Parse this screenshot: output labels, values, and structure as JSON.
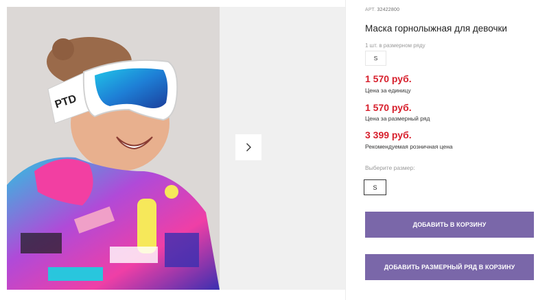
{
  "gallery": {
    "next_icon": "chevron-right-icon",
    "goggle_strap_text": "PTD"
  },
  "product": {
    "art_label": "АРТ.",
    "art_number": "32422800",
    "title": "Маска горнолыжная для девочки",
    "pack_label": "1 шт. в размерном ряду",
    "pack_size": "S"
  },
  "prices": [
    {
      "value": "1 570 руб.",
      "note": "Цена за единицу"
    },
    {
      "value": "1 570 руб.",
      "note": "Цена за размерный ряд"
    },
    {
      "value": "3 399 руб.",
      "note": "Рекомендуемая розничная цена"
    }
  ],
  "size_select": {
    "label": "Выберите размер:",
    "options": [
      "S"
    ]
  },
  "actions": {
    "add_to_cart": "ДОБАВИТЬ В КОРЗИНУ",
    "add_size_row": "ДОБАВИТЬ РАЗМЕРНЫЙ РЯД В КОРЗИНУ"
  },
  "colors": {
    "price": "#d71f2c",
    "button": "#7a67a9"
  }
}
